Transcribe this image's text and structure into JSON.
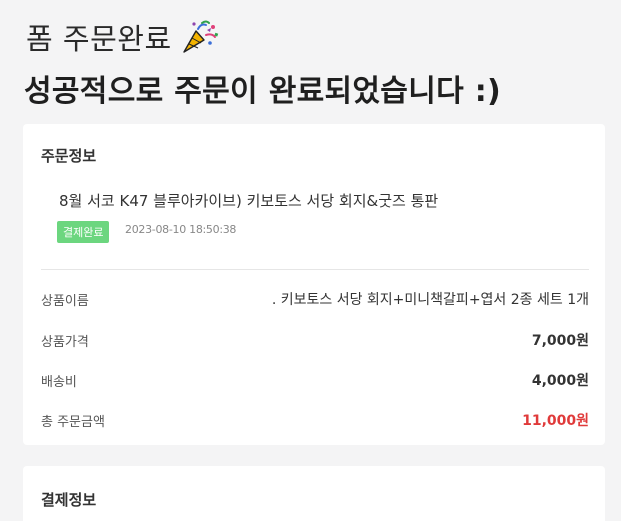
{
  "header": {
    "title": "폼 주문완료",
    "headline": "성공적으로 주문이 완료되었습니다 :)"
  },
  "order_info": {
    "section_title": "주문정보",
    "product_name": "8월 서코 K47 블루아카이브) 키보토스 서당 회지&굿즈 통판",
    "status_badge": "결제완료",
    "order_date": "2023-08-10 18:50:38",
    "rows": [
      {
        "label": "상품이름",
        "value": ". 키보토스 서당 회지+미니책갈피+엽서 2종 세트 1개"
      },
      {
        "label": "상품가격",
        "value": "7,000원"
      },
      {
        "label": "배송비",
        "value": "4,000원"
      },
      {
        "label": "총 주문금액",
        "value": "11,000원"
      }
    ]
  },
  "payment_info": {
    "section_title": "결제정보"
  },
  "colors": {
    "badge": "#6cd67f",
    "total": "#e03a3a",
    "background": "#f4f4f5"
  },
  "icons": {
    "title_icon": "party-popper-icon"
  }
}
